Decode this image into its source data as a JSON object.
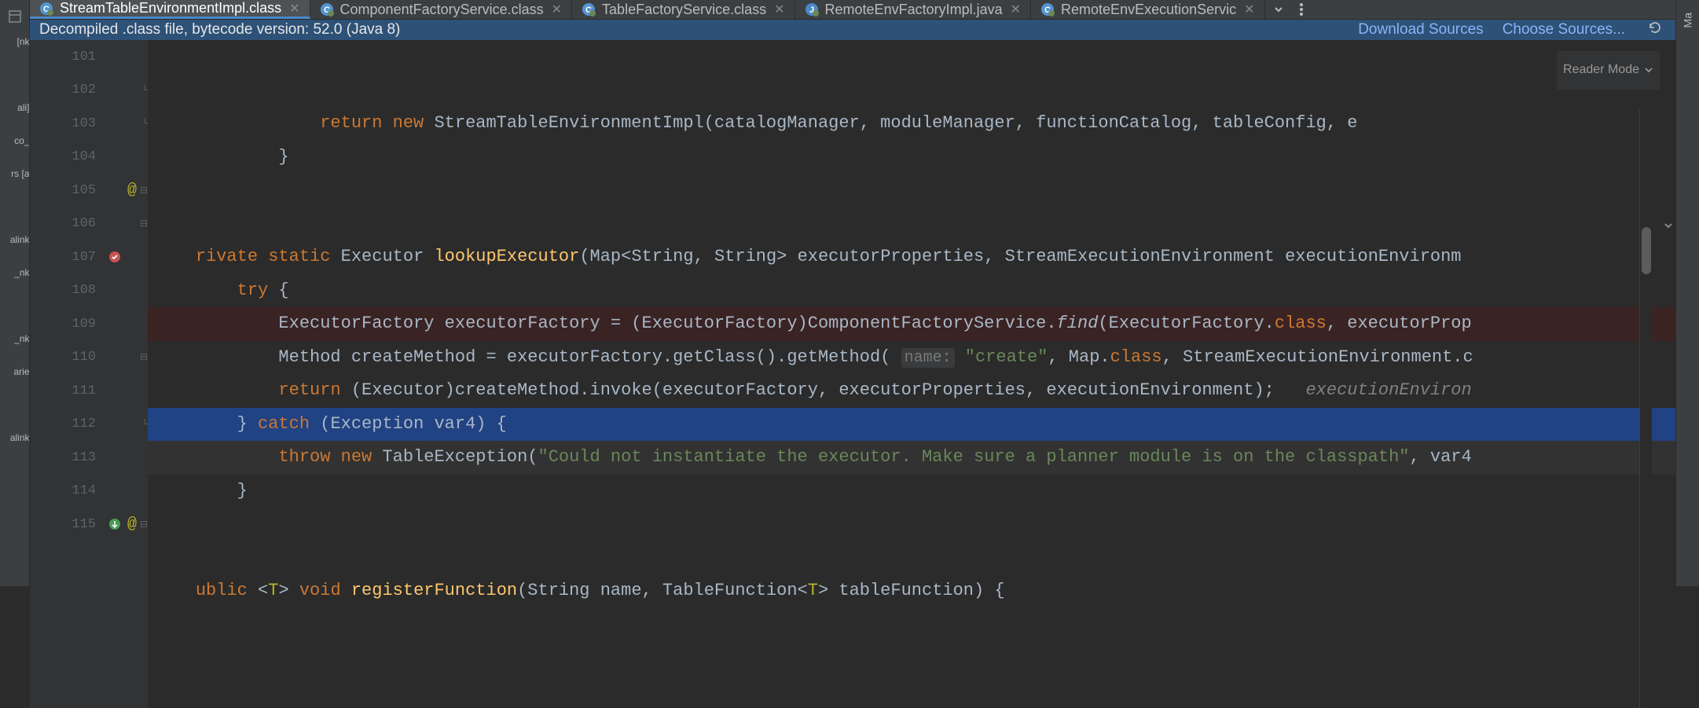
{
  "sidebar_frags": [
    "nk]",
    "",
    "[ali",
    "_co",
    "rs [a",
    "",
    "alink",
    "nk_",
    "",
    "nk_",
    "arie",
    "",
    "alink"
  ],
  "tabs": [
    {
      "label": "StreamTableEnvironmentImpl.class",
      "active": true,
      "type": "class"
    },
    {
      "label": "ComponentFactoryService.class",
      "active": false,
      "type": "class"
    },
    {
      "label": "TableFactoryService.class",
      "active": false,
      "type": "class"
    },
    {
      "label": "RemoteEnvFactoryImpl.java",
      "active": false,
      "type": "java"
    },
    {
      "label": "RemoteEnvExecutionServic",
      "active": false,
      "type": "class"
    }
  ],
  "banner": {
    "message": "Decompiled .class file, bytecode version: 52.0 (Java 8)",
    "link1": "Download Sources",
    "link2": "Choose Sources..."
  },
  "reader_mode": "Reader Mode",
  "right_strip": "Ma",
  "lines": [
    {
      "n": "101",
      "fold": "",
      "html": "            <span class='kw'>return</span> <span class='kw'>new</span> StreamTableEnvironmentImpl(catalogManager, moduleManager, functionCatalog, tableConfig, e"
    },
    {
      "n": "102",
      "fold": "└",
      "html": "        }"
    },
    {
      "n": "103",
      "fold": "└",
      "html": ""
    },
    {
      "n": "104",
      "fold": "",
      "html": ""
    },
    {
      "n": "105",
      "fold": "┌",
      "annot": "@",
      "html": "<span class='kw'>rivate</span> <span class='kw'>static</span> Executor <span class='meth'>lookupExecutor</span>(Map&lt;String, String&gt; executorProperties, StreamExecutionEnvironment executionEnvironm"
    },
    {
      "n": "106",
      "fold": "┌",
      "html": "    <span class='kw'>try</span> {"
    },
    {
      "n": "107",
      "fold": "",
      "bp": true,
      "hl": "bp",
      "html": "        ExecutorFactory executorFactory = (ExecutorFactory)ComponentFactoryService.<span class='italic'>find</span>(ExecutorFactory.<span class='kw'>class</span>, executorProp"
    },
    {
      "n": "108",
      "fold": "",
      "html": "        Method createMethod = executorFactory.getClass().getMethod( <span class='hint'>name:</span> <span class='str'>\"create\"</span>, Map.<span class='kw'>class</span>, StreamExecutionEnvironment.c"
    },
    {
      "n": "109",
      "fold": "",
      "html": "        <span class='kw'>return</span> (Executor)createMethod.invoke(executorFactory, executorProperties, executionEnvironment);   <span class='comment'>executionEnviron</span>"
    },
    {
      "n": "110",
      "fold": "┌",
      "hl": "sel",
      "html": "    } <span class='kw'>catch</span> (Exception var4) {"
    },
    {
      "n": "111",
      "fold": "",
      "caret": true,
      "html": "        <span class='kw'>throw</span> <span class='kw'>new</span> TableException(<span class='str'>\"Could not instantiate the executor. Make sure a planner module is on the classpath\"</span>, var4"
    },
    {
      "n": "112",
      "fold": "└",
      "html": "    }"
    },
    {
      "n": "113",
      "fold": "",
      "html": ""
    },
    {
      "n": "114",
      "fold": "",
      "html": ""
    },
    {
      "n": "115",
      "fold": "┌",
      "annot": "@",
      "break_green": true,
      "html": "<span class='kw'>ublic</span> &lt;<span class='annot'>T</span>&gt; <span class='kw'>void</span> <span class='meth'>registerFunction</span>(String name, TableFunction&lt;<span class='annot'>T</span>&gt; tableFunction) {"
    }
  ]
}
